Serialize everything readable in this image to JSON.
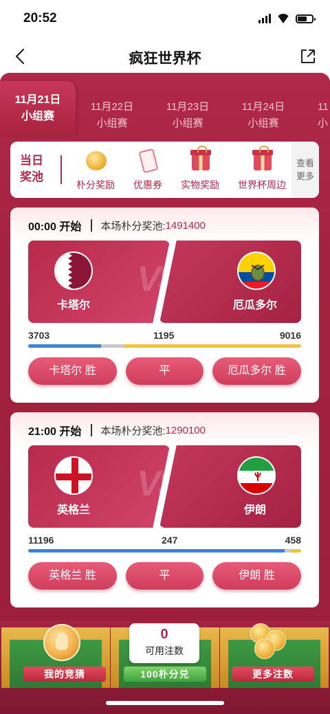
{
  "status": {
    "time": "20:52"
  },
  "nav": {
    "title": "疯狂世界杯"
  },
  "tabs": [
    {
      "date": "11月21日",
      "stage": "小组赛",
      "active": true
    },
    {
      "date": "11月22日",
      "stage": "小组赛"
    },
    {
      "date": "11月23日",
      "stage": "小组赛"
    },
    {
      "date": "11月24日",
      "stage": "小组赛"
    },
    {
      "date": "11",
      "stage": "小"
    }
  ],
  "prize": {
    "today_label": "当日奖池",
    "items": [
      {
        "label": "朴分奖励",
        "icon": "coin-icon"
      },
      {
        "label": "优惠券",
        "icon": "ticket-icon"
      },
      {
        "label": "实物奖励",
        "icon": "gift-icon"
      },
      {
        "label": "世界杯周边",
        "icon": "gift-icon"
      }
    ],
    "more_label": "查看更多"
  },
  "matches": [
    {
      "time": "00:00 开始",
      "pool_label": "本场朴分奖池:",
      "pool_value": "1491400",
      "home": {
        "name": "卡塔尔",
        "flag": "qatar"
      },
      "away": {
        "name": "厄瓜多尔",
        "flag": "ecuador"
      },
      "odds": {
        "home": 3703,
        "draw": 1195,
        "away": 9016
      },
      "buttons": {
        "home": "卡塔尔 胜",
        "draw": "平",
        "away": "厄瓜多尔 胜"
      }
    },
    {
      "time": "21:00 开始",
      "pool_label": "本场朴分奖池:",
      "pool_value": "1290100",
      "home": {
        "name": "英格兰",
        "flag": "england"
      },
      "away": {
        "name": "伊朗",
        "flag": "iran"
      },
      "odds": {
        "home": 11196,
        "draw": 247,
        "away": 458
      },
      "buttons": {
        "home": "英格兰 胜",
        "draw": "平",
        "away": "伊朗 胜"
      }
    }
  ],
  "dock": {
    "my_bets": "我的竞猜",
    "counter_value": "0",
    "counter_label": "可用注数",
    "exchange": "100朴分兑",
    "more_bets": "更多注数"
  },
  "colors": {
    "accent": "#b0284a",
    "home_bar": "#3f82d8",
    "draw_bar": "#c9c9c9",
    "away_bar": "#efc53c"
  }
}
